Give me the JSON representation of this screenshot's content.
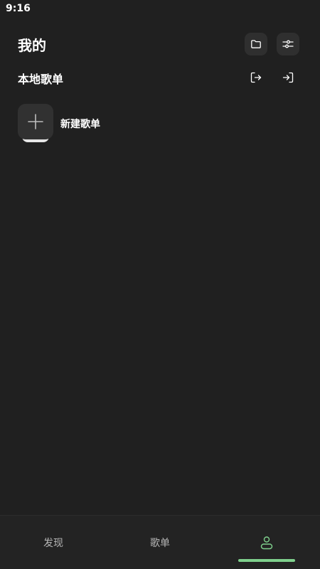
{
  "status_bar": {
    "time": "9:16"
  },
  "header": {
    "title": "我的",
    "folder_icon": "folder-icon",
    "settings_icon": "sliders-icon"
  },
  "local_playlists": {
    "title": "本地歌单",
    "export_icon": "export-icon",
    "import_icon": "import-icon",
    "new_playlist_label": "新建歌单",
    "add_icon": "plus-icon"
  },
  "bottom_nav": {
    "items": [
      {
        "label": "发现"
      },
      {
        "label": "歌单"
      },
      {
        "label": "",
        "icon": "user-icon",
        "active": true
      }
    ],
    "active_color": "#7fd08d"
  }
}
